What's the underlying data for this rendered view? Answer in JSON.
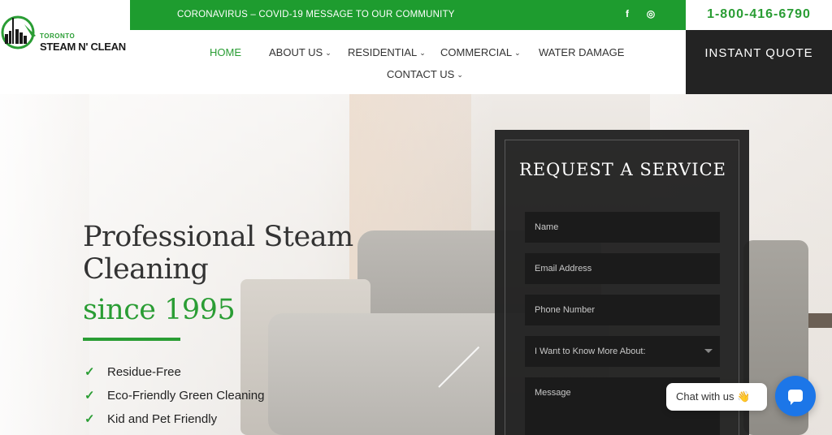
{
  "logo": {
    "small": "TORONTO",
    "big": "STEAM N' CLEAN"
  },
  "topbar": {
    "message": "CORONAVIRUS – COVID-19 MESSAGE TO OUR COMMUNITY",
    "facebook": "f",
    "instagram": "◎"
  },
  "phone": "1-800-416-6790",
  "nav": {
    "home": "HOME",
    "about": "ABOUT US",
    "residential": "RESIDENTIAL",
    "commercial": "COMMERCIAL",
    "water_damage": "WATER DAMAGE",
    "contact": "CONTACT US",
    "chevron": "⌄"
  },
  "cta": {
    "instant_quote": "INSTANT QUOTE"
  },
  "hero": {
    "title": "Professional Steam Cleaning",
    "subtitle": "since 1995",
    "features": [
      "Residue-Free",
      "Eco-Friendly Green Cleaning",
      "Kid and Pet Friendly"
    ],
    "check": "✓"
  },
  "form": {
    "title": "REQUEST A SERVICE",
    "name": "Name",
    "email": "Email Address",
    "phone": "Phone Number",
    "interest": "I Want to Know More About:",
    "message": "Message"
  },
  "chat": {
    "label": "Chat with us",
    "emoji": "👋"
  },
  "colors": {
    "accent": "#2a9d34",
    "topbar": "#1e9c2f",
    "dark": "#232323",
    "chat": "#1c76e8"
  }
}
